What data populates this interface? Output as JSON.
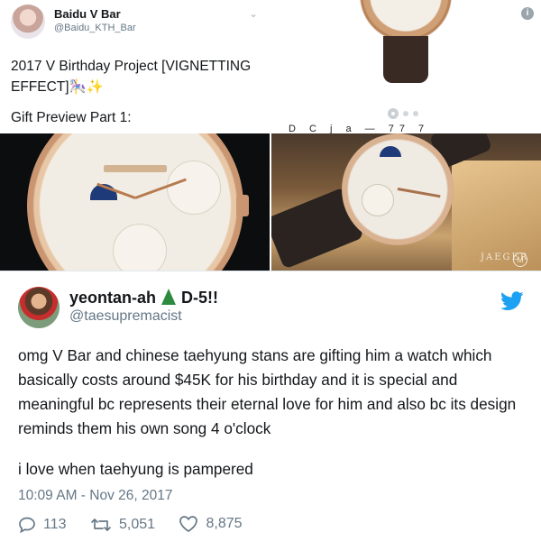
{
  "quoted_tweet": {
    "name": "Baidu V Bar",
    "handle": "@Baidu_KTH_Bar",
    "text_line1": "2017 V Birthday Project [VIGNETTING",
    "text_line2": "EFFECT]🎠✨",
    "preview_label": "Gift Preview Part 1:",
    "carousel_cut_text": "D  C  j  a  — 77 7",
    "carousel": {
      "pages": 3,
      "active": 1
    },
    "photos": [
      {
        "subject": "watch-closeup-left"
      },
      {
        "subject": "watch-on-box-right",
        "brand_text": "JAEGER",
        "brand_badge": "M"
      }
    ]
  },
  "tweet": {
    "name": "yeontan-ah",
    "name_suffix": "D-5!!",
    "handle": "@taesupremacist",
    "text": "omg V Bar and chinese taehyung stans are gifting him a watch which basically costs around $45K for his birthday and it is special and meaningful bc represents their eternal love for him and also bc its design reminds them his own song 4 o'clock",
    "text2": "i love when taehyung is pampered",
    "timestamp": "10:09 AM - Nov 26, 2017",
    "replies": "113",
    "retweets": "5,051",
    "likes": "8,875"
  },
  "colors": {
    "twitter_blue": "#1da1f2",
    "secondary_text": "#657786",
    "primary_text": "#14171a"
  },
  "icons": [
    "chevron-down-icon",
    "info-icon",
    "christmas-tree-icon",
    "twitter-bird-icon",
    "reply-icon",
    "retweet-icon",
    "heart-icon"
  ]
}
